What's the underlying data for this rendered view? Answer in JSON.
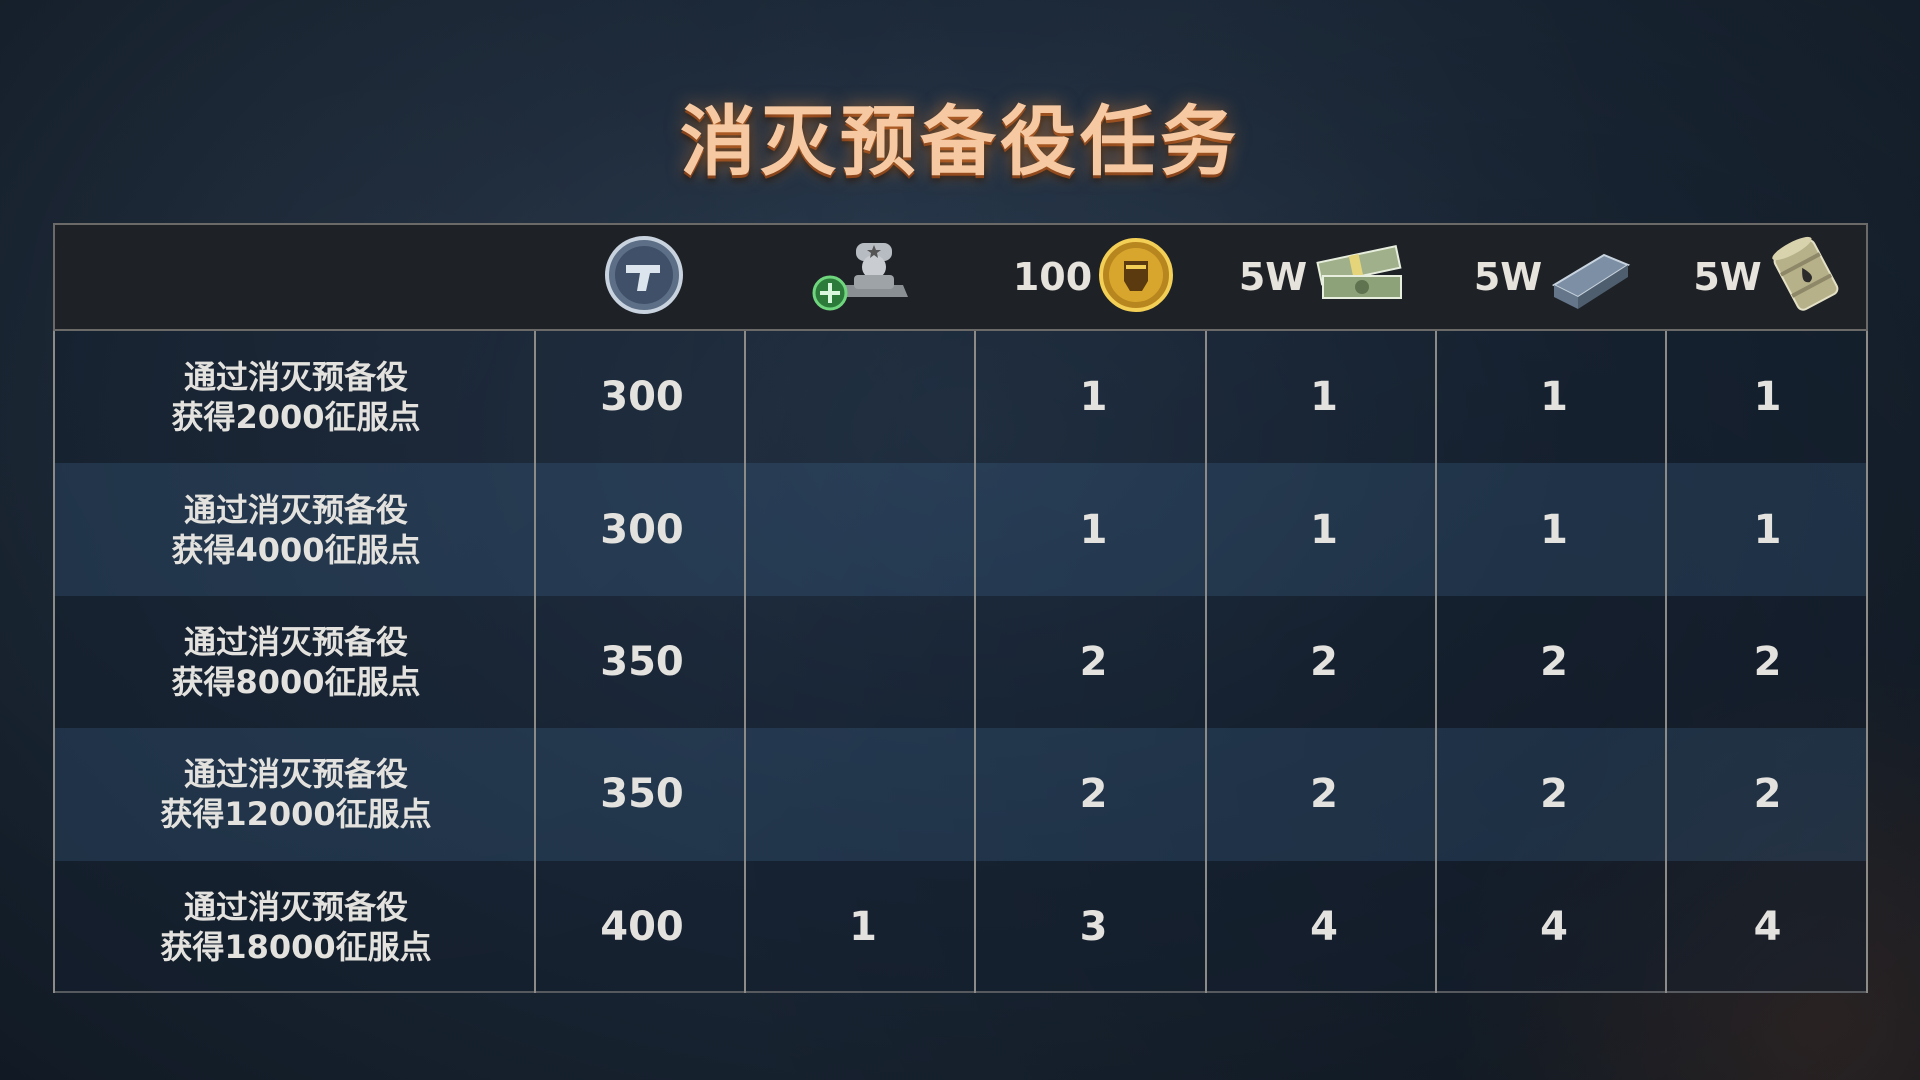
{
  "title": "消灭预备役任务",
  "header": [
    {
      "text": "",
      "icon": "pistol-coin-icon"
    },
    {
      "text": "",
      "icon": "soldier-rank-icon"
    },
    {
      "text": "100",
      "icon": "gold-fist-medal-icon"
    },
    {
      "text": "5W",
      "icon": "cash-stack-icon"
    },
    {
      "text": "5W",
      "icon": "steel-beam-icon"
    },
    {
      "text": "5W",
      "icon": "oil-barrel-icon"
    }
  ],
  "rows": [
    {
      "task": [
        "通过消灭预备役",
        "获得2000征服点"
      ],
      "values": [
        "300",
        "",
        "1",
        "1",
        "1",
        "1"
      ]
    },
    {
      "task": [
        "通过消灭预备役",
        "获得4000征服点"
      ],
      "values": [
        "300",
        "",
        "1",
        "1",
        "1",
        "1"
      ]
    },
    {
      "task": [
        "通过消灭预备役",
        "获得8000征服点"
      ],
      "values": [
        "350",
        "",
        "2",
        "2",
        "2",
        "2"
      ]
    },
    {
      "task": [
        "通过消灭预备役",
        "获得12000征服点"
      ],
      "values": [
        "350",
        "",
        "2",
        "2",
        "2",
        "2"
      ]
    },
    {
      "task": [
        "通过消灭预备役",
        "获得18000征服点"
      ],
      "values": [
        "400",
        "1",
        "3",
        "4",
        "4",
        "4"
      ]
    }
  ],
  "colors": {
    "title": "#f6c9a2",
    "text": "#e4e2de",
    "border": "#8d8b88"
  }
}
